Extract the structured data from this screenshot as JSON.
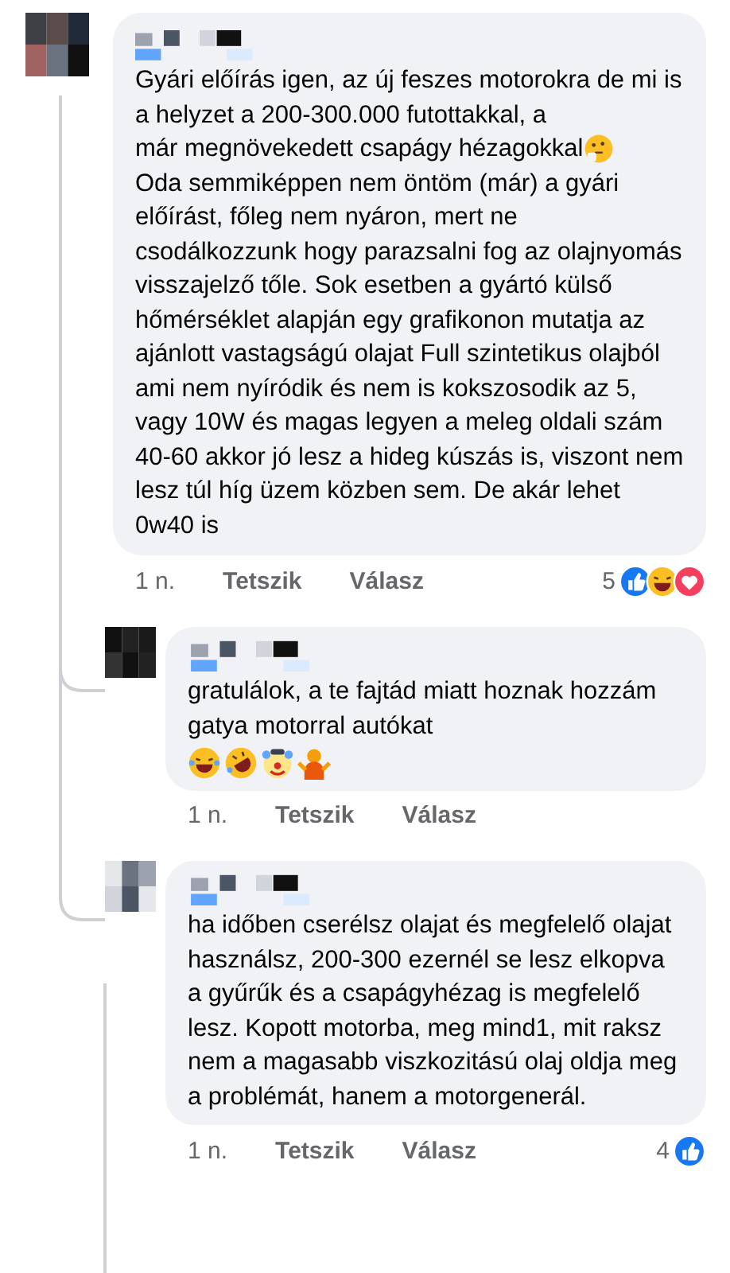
{
  "comment": {
    "text_1": "Gyári előírás igen, az új feszes motorokra de mi is a helyzet a 200-300.000 futottakkal, a",
    "text_2": "már megnövekedett csapágy hézagokkal",
    "text_2_emoji": {
      "kind": "thinking"
    },
    "text_3": "Oda semmiképpen nem öntöm (már) a gyári előírást, főleg nem nyáron, mert ne csodálkozzunk hogy parazsalni fog az olajnyomás visszajelző tőle. Sok esetben a gyártó külső hőmérséklet alapján egy grafikonon mutatja az ajánlott  vastagságú olajat Full szintetikus olajból ami nem nyíródik és nem is kokszosodik az 5, vagy 10W és magas legyen a meleg oldali szám 40-60 akkor jó lesz a hideg kúszás is, viszont nem lesz túl híg üzem közben sem. De akár lehet 0w40 is",
    "time": "1 n.",
    "like": "Tetszik",
    "reply": "Válasz",
    "reaction_count": "5",
    "reactions": [
      {
        "kind": "like"
      },
      {
        "kind": "haha"
      },
      {
        "kind": "love"
      }
    ],
    "replies": [
      {
        "text": "gratulálok, a te fajtád miatt hoznak hozzám gatya motorral autókat",
        "emojis": [
          {
            "kind": "laugh"
          },
          {
            "kind": "rofl"
          },
          {
            "kind": "clown"
          },
          {
            "kind": "shrug"
          }
        ],
        "time": "1 n.",
        "like": "Tetszik",
        "reply": "Válasz"
      },
      {
        "text": "ha időben cserélsz olajat és megfelelő olajat használsz, 200-300 ezernél se lesz elkopva a gyűrűk és a csapágyhézag is megfelelő lesz. Kopott motorba, meg mind1, mit raksz nem a magasabb viszkozitású olaj oldja meg a problémát, hanem a motorgenerál.",
        "time": "1 n.",
        "like": "Tetszik",
        "reply": "Válasz",
        "reaction_count": "4",
        "reactions": [
          {
            "kind": "like"
          }
        ]
      }
    ]
  }
}
